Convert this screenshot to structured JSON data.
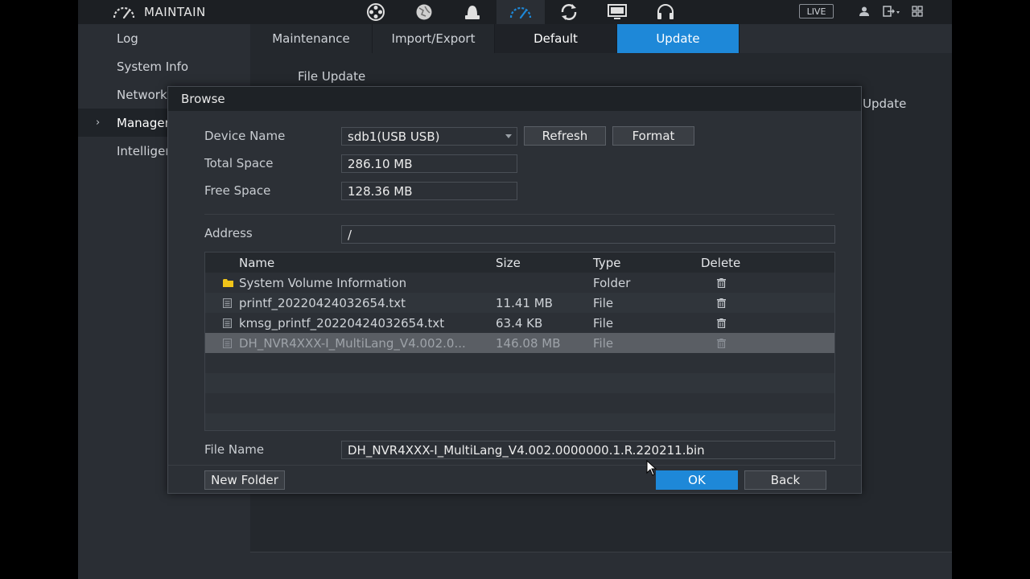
{
  "header": {
    "title": "MAINTAIN",
    "live_label": "LIVE",
    "nav_icons": [
      "camera-reels-icon",
      "network-icon",
      "storage-icon",
      "maintain-gauge-icon",
      "refresh-backup-icon",
      "display-monitor-icon",
      "audio-headset-icon"
    ],
    "right_icons": [
      "user-icon",
      "logout-icon",
      "grid-icon"
    ]
  },
  "sidebar": {
    "items": [
      {
        "label": "Log"
      },
      {
        "label": "System Info"
      },
      {
        "label": "Network"
      },
      {
        "label": "Manager"
      },
      {
        "label": "Intelligent"
      }
    ]
  },
  "tabs": [
    {
      "label": "Maintenance"
    },
    {
      "label": "Import/Export"
    },
    {
      "label": "Default"
    },
    {
      "label": "Update"
    }
  ],
  "content": {
    "file_update_label": "File Update",
    "update_peek": "Update"
  },
  "dialog": {
    "title": "Browse",
    "device_name_label": "Device Name",
    "device_name_value": "sdb1(USB USB)",
    "refresh_label": "Refresh",
    "format_label": "Format",
    "total_space_label": "Total Space",
    "total_space_value": "286.10 MB",
    "free_space_label": "Free Space",
    "free_space_value": "128.36 MB",
    "address_label": "Address",
    "address_value": "/",
    "table": {
      "columns": [
        "Name",
        "Size",
        "Type",
        "Delete"
      ],
      "rows": [
        {
          "name": "System Volume Information",
          "size": "",
          "type": "Folder",
          "icon": "folder-icon"
        },
        {
          "name": "printf_20220424032654.txt",
          "size": "11.41 MB",
          "type": "File",
          "icon": "file-icon"
        },
        {
          "name": "kmsg_printf_20220424032654.txt",
          "size": "63.4 KB",
          "type": "File",
          "icon": "file-icon"
        },
        {
          "name": "DH_NVR4XXX-I_MultiLang_V4.002.0...",
          "size": "146.08 MB",
          "type": "File",
          "icon": "file-icon"
        }
      ]
    },
    "file_name_label": "File Name",
    "file_name_value": "DH_NVR4XXX-I_MultiLang_V4.002.0000000.1.R.220211.bin",
    "new_folder_label": "New Folder",
    "ok_label": "OK",
    "back_label": "Back"
  },
  "colors": {
    "accent": "#1e88d8",
    "background": "#2a2e34",
    "topbar": "#1c1f23"
  }
}
